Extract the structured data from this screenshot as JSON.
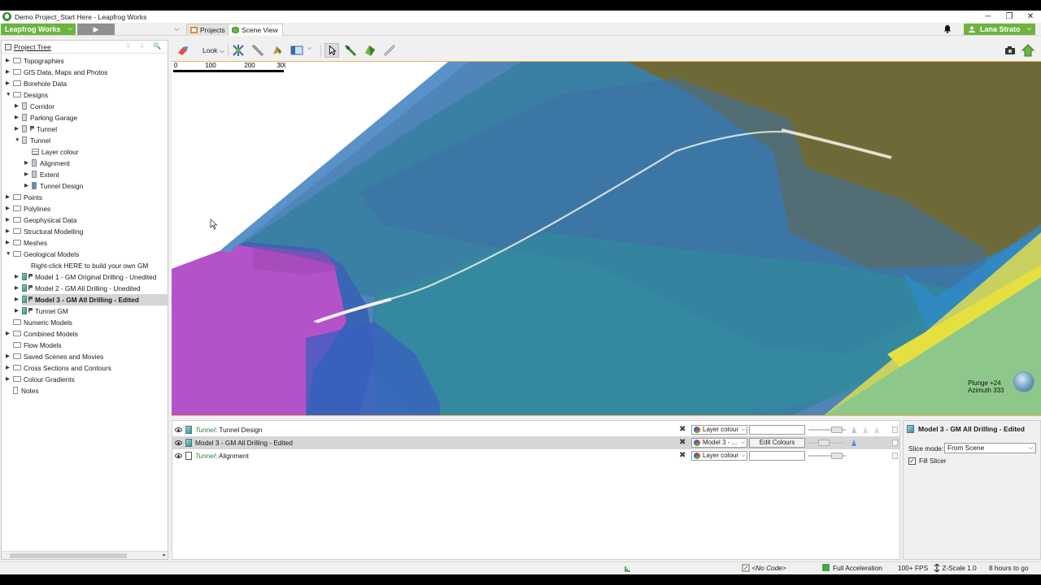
{
  "window": {
    "title": "Demo Project_Start Here - Leapfrog Works",
    "minimize": "─",
    "restore": "❐",
    "close": "✕"
  },
  "topbar": {
    "brand": "Leapfrog Works",
    "brand_caret": "⌵",
    "play": "▶",
    "tab_caret": "⌵",
    "tabs": [
      {
        "label": "Projects"
      },
      {
        "label": "Scene View"
      }
    ],
    "user": "Lana Strato",
    "user_caret": "⌵"
  },
  "project_tree": {
    "title": "Project Tree",
    "tools": "⇧ ⇩ 🔍",
    "items": [
      {
        "label": "Topographies",
        "toggle": "▶"
      },
      {
        "label": "GIS Data, Maps and Photos",
        "toggle": "▶"
      },
      {
        "label": "Borehole Data",
        "toggle": "▶"
      },
      {
        "label": "Designs",
        "toggle": "▼"
      },
      {
        "label": "Corridor",
        "toggle": "▶"
      },
      {
        "label": "Parking Garage",
        "toggle": "▶"
      },
      {
        "label": "Tunnel",
        "toggle": "▶"
      },
      {
        "label": "Tunnel",
        "toggle": "▼"
      },
      {
        "label": "Layer colour",
        "toggle": ""
      },
      {
        "label": "Alignment",
        "toggle": "▶"
      },
      {
        "label": "Extent",
        "toggle": "▶"
      },
      {
        "label": "Tunnel Design",
        "toggle": "▶"
      },
      {
        "label": "Points",
        "toggle": "▶"
      },
      {
        "label": "Polylines",
        "toggle": "▶"
      },
      {
        "label": "Geophysical Data",
        "toggle": "▶"
      },
      {
        "label": "Structural Modelling",
        "toggle": "▶"
      },
      {
        "label": "Meshes",
        "toggle": "▶"
      },
      {
        "label": "Geological Models",
        "toggle": "▼"
      },
      {
        "label": "Right-click HERE to build your own GM",
        "toggle": ""
      },
      {
        "label": "Model 1 - GM Original Drilling - Unedited",
        "toggle": "▶"
      },
      {
        "label": "Model 2 - GM All Drilling - Unedited",
        "toggle": "▶"
      },
      {
        "label": "Model 3 - GM All Drilling - Edited",
        "toggle": "▶"
      },
      {
        "label": "Tunnel GM",
        "toggle": "▶"
      },
      {
        "label": "Numeric Models",
        "toggle": ""
      },
      {
        "label": "Combined Models",
        "toggle": "▶"
      },
      {
        "label": "Flow Models",
        "toggle": ""
      },
      {
        "label": "Saved Scenes and Movies",
        "toggle": "▶"
      },
      {
        "label": "Cross Sections and Contours",
        "toggle": "▶"
      },
      {
        "label": "Colour Gradients",
        "toggle": "▶"
      },
      {
        "label": "Notes",
        "toggle": ""
      }
    ],
    "scroll_arrow": "▸"
  },
  "toolbar": {
    "look": "Look",
    "look_caret": "⌵",
    "view_caret": "⌵"
  },
  "scene": {
    "plunge": "Plunge +24",
    "azimuth": "Azimuth 333",
    "scale_labels": [
      "0",
      "100",
      "200",
      "300"
    ]
  },
  "shown_objects": [
    {
      "prefix": "Tunnel",
      "name": ": Tunnel Design",
      "remove": "✖",
      "colour": "Layer colour",
      "value": ""
    },
    {
      "prefix": "",
      "name": "Model 3 - GM All Drilling - Edited",
      "remove": "✖",
      "colour": "Model 3 - ...",
      "value": "Edit Colours"
    },
    {
      "prefix": "Tunnel",
      "name": ": Alignment",
      "remove": "✖",
      "colour": "Layer colour",
      "value": ""
    }
  ],
  "dd_caret": "⌵",
  "properties": {
    "title": "Model 3 - GM All Drilling - Edited",
    "slice_mode_label": "Slice mode:",
    "slice_mode_value": "From Scene",
    "fill_slicer_label": "Fill Slicer",
    "fill_slicer_checked": "✓"
  },
  "status": {
    "code": "<No Code>",
    "acceleration": "Full Acceleration",
    "fps": "100+ FPS",
    "zscale": "Z-Scale 1.0",
    "remaining": "8 hours to go"
  }
}
